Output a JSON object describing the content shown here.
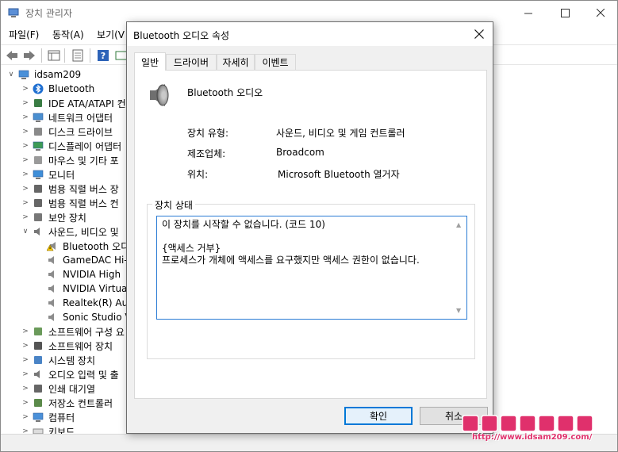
{
  "devmgr": {
    "title": "장치 관리자",
    "menu": [
      "파일(F)",
      "동작(A)",
      "보기(V"
    ],
    "tree": [
      {
        "label": "idsam209",
        "level": 0,
        "expander": "∨",
        "icon": "computer-icon"
      },
      {
        "label": "Bluetooth",
        "level": 1,
        "expander": ">",
        "icon": "bluetooth-icon"
      },
      {
        "label": "IDE ATA/ATAPI 컨",
        "level": 1,
        "expander": ">",
        "icon": "ide-controller-icon"
      },
      {
        "label": "네트워크 어댑터",
        "level": 1,
        "expander": ">",
        "icon": "network-adapter-icon"
      },
      {
        "label": "디스크 드라이브",
        "level": 1,
        "expander": ">",
        "icon": "disk-drive-icon"
      },
      {
        "label": "디스플레이 어댑터",
        "level": 1,
        "expander": ">",
        "icon": "display-adapter-icon"
      },
      {
        "label": "마우스 및 기타 포",
        "level": 1,
        "expander": ">",
        "icon": "mouse-icon"
      },
      {
        "label": "모니터",
        "level": 1,
        "expander": ">",
        "icon": "monitor-icon"
      },
      {
        "label": "범용 직렬 버스 장",
        "level": 1,
        "expander": ">",
        "icon": "usb-icon"
      },
      {
        "label": "범용 직렬 버스 컨",
        "level": 1,
        "expander": ">",
        "icon": "usb-controller-icon"
      },
      {
        "label": "보안 장치",
        "level": 1,
        "expander": ">",
        "icon": "security-device-icon"
      },
      {
        "label": "사운드, 비디오 및",
        "level": 1,
        "expander": "∨",
        "icon": "sound-icon"
      },
      {
        "label": "Bluetooth 오디",
        "level": 2,
        "expander": "",
        "icon": "speaker-warning-icon"
      },
      {
        "label": "GameDAC Hi-",
        "level": 2,
        "expander": "",
        "icon": "speaker-icon"
      },
      {
        "label": "NVIDIA High",
        "level": 2,
        "expander": "",
        "icon": "speaker-icon"
      },
      {
        "label": "NVIDIA Virtua",
        "level": 2,
        "expander": "",
        "icon": "speaker-icon"
      },
      {
        "label": "Realtek(R) Au",
        "level": 2,
        "expander": "",
        "icon": "speaker-icon"
      },
      {
        "label": "Sonic Studio V",
        "level": 2,
        "expander": "",
        "icon": "speaker-icon"
      },
      {
        "label": "소프트웨어 구성 요",
        "level": 1,
        "expander": ">",
        "icon": "software-component-icon"
      },
      {
        "label": "소프트웨어 장치",
        "level": 1,
        "expander": ">",
        "icon": "software-device-icon"
      },
      {
        "label": "시스템 장치",
        "level": 1,
        "expander": ">",
        "icon": "system-device-icon"
      },
      {
        "label": "오디오 입력 및 출",
        "level": 1,
        "expander": ">",
        "icon": "audio-io-icon"
      },
      {
        "label": "인쇄 대기열",
        "level": 1,
        "expander": ">",
        "icon": "printer-icon"
      },
      {
        "label": "저장소 컨트롤러",
        "level": 1,
        "expander": ">",
        "icon": "storage-controller-icon"
      },
      {
        "label": "컴퓨터",
        "level": 1,
        "expander": ">",
        "icon": "computer-icon"
      },
      {
        "label": "키보드",
        "level": 1,
        "expander": ">",
        "icon": "keyboard-icon"
      }
    ]
  },
  "dialog": {
    "title": "Bluetooth 오디오 속성",
    "tabs": [
      "일반",
      "드라이버",
      "자세히",
      "이벤트"
    ],
    "active_tab": "일반",
    "device_name": "Bluetooth 오디오",
    "props": [
      {
        "label": "장치 유형:",
        "value": "사운드, 비디오 및 게임 컨트롤러"
      },
      {
        "label": "제조업체:",
        "value": "Broadcom"
      },
      {
        "label": "위치:",
        "value": "Microsoft Bluetooth 열거자"
      }
    ],
    "status_group_label": "장치 상태",
    "status_lines": [
      "이 장치를 시작할 수 없습니다. (코드 10)",
      "",
      "{액세스 거부}",
      "프로세스가 개체에 액세스를 요구했지만 액세스 권한이 없습니다."
    ],
    "ok_label": "확인",
    "cancel_label": "취소"
  },
  "watermark": {
    "text": "http://www.idsam209.com/"
  },
  "colors": {
    "accent": "#0078d7",
    "dialog_bg": "#f0f0f0",
    "watermark_pink": "#e0306c"
  }
}
